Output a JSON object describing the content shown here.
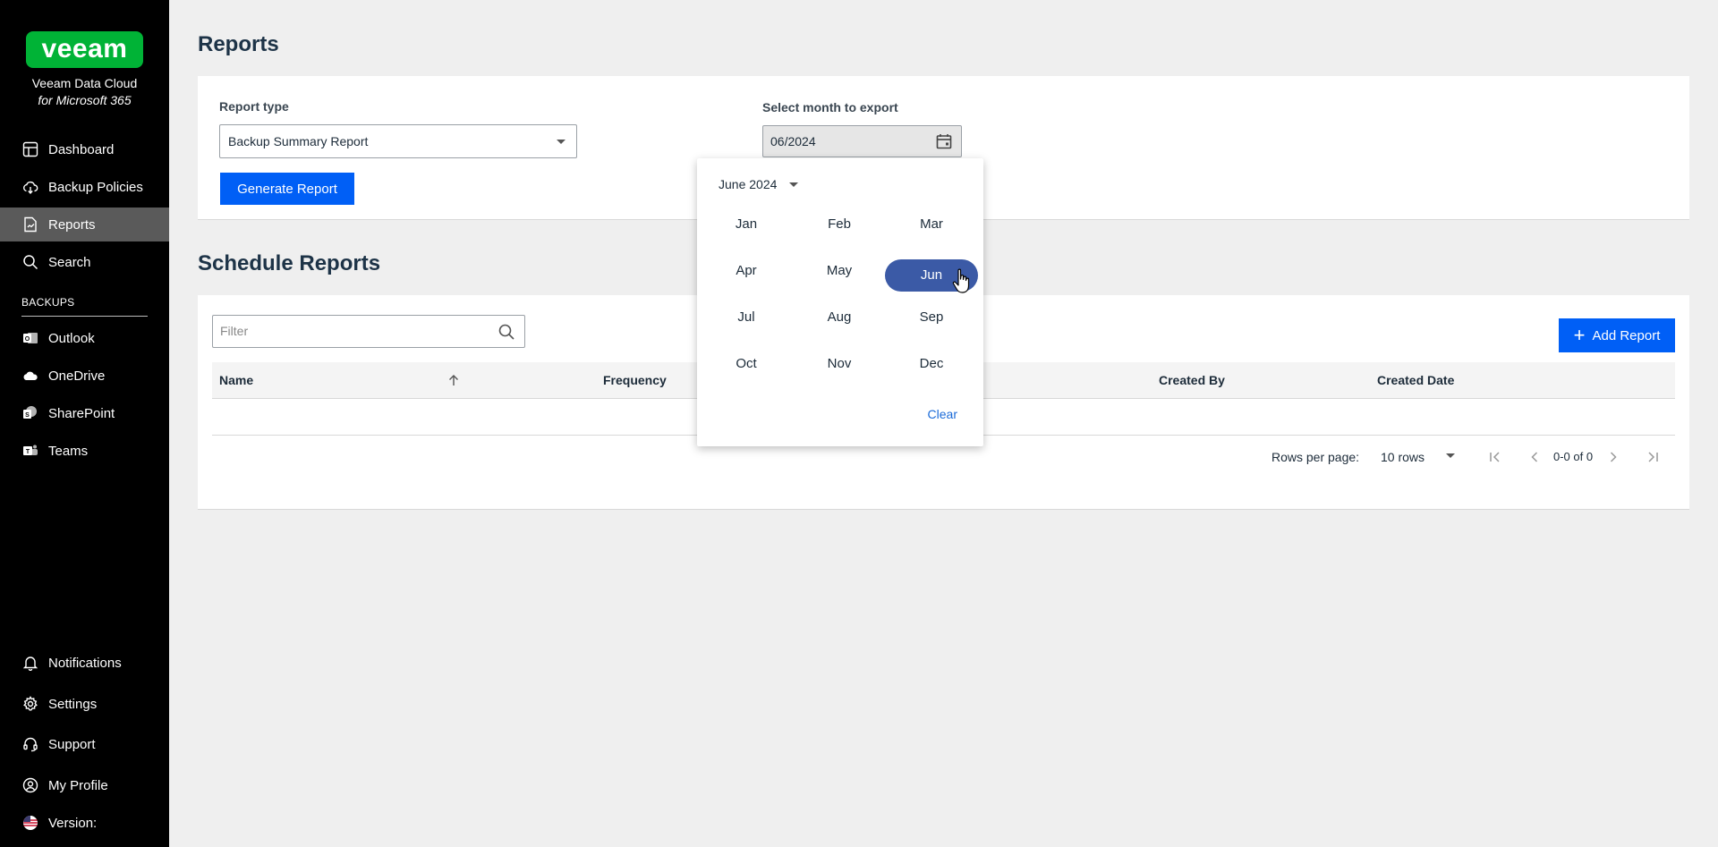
{
  "sidebar": {
    "logo_text": "veeam",
    "brand_name": "Veeam Data Cloud",
    "brand_sub": "for Microsoft 365",
    "nav": [
      {
        "label": "Dashboard",
        "icon": "dashboard-icon"
      },
      {
        "label": "Backup Policies",
        "icon": "cloud-upload-icon"
      },
      {
        "label": "Reports",
        "icon": "report-icon",
        "active": true
      },
      {
        "label": "Search",
        "icon": "search-icon"
      }
    ],
    "backups_label": "BACKUPS",
    "backups": [
      {
        "label": "Outlook",
        "icon": "outlook-icon"
      },
      {
        "label": "OneDrive",
        "icon": "onedrive-icon"
      },
      {
        "label": "SharePoint",
        "icon": "sharepoint-icon"
      },
      {
        "label": "Teams",
        "icon": "teams-icon"
      }
    ],
    "bottom": [
      {
        "label": "Notifications",
        "icon": "bell-icon"
      },
      {
        "label": "Settings",
        "icon": "gear-icon"
      },
      {
        "label": "Support",
        "icon": "headset-icon"
      },
      {
        "label": "My Profile",
        "icon": "profile-icon"
      },
      {
        "label": "Version:",
        "icon": "us-flag-icon"
      }
    ]
  },
  "page": {
    "title": "Reports",
    "report_type_label": "Report type",
    "report_type_value": "Backup Summary Report",
    "month_label": "Select month to export",
    "month_value": "06/2024",
    "generate_label": "Generate Report"
  },
  "schedule": {
    "title": "Schedule Reports",
    "filter_placeholder": "Filter",
    "add_label": "Add Report",
    "columns": [
      "Name",
      "Frequency",
      "Created By",
      "Created Date"
    ],
    "rows": [],
    "rows_per_page_label": "Rows per page:",
    "rows_per_page_value": "10 rows",
    "range_text": "0-0 of 0"
  },
  "month_picker": {
    "header": "June 2024",
    "months": [
      "Jan",
      "Feb",
      "Mar",
      "Apr",
      "May",
      "Jun",
      "Jul",
      "Aug",
      "Sep",
      "Oct",
      "Nov",
      "Dec"
    ],
    "selected": "Jun",
    "clear_label": "Clear"
  },
  "colors": {
    "sidebar_bg": "#000000",
    "brand_green": "#00b336",
    "primary_blue": "#005ff6",
    "selected_month": "#3b5aa6",
    "active_nav": "#5a5a5a"
  }
}
